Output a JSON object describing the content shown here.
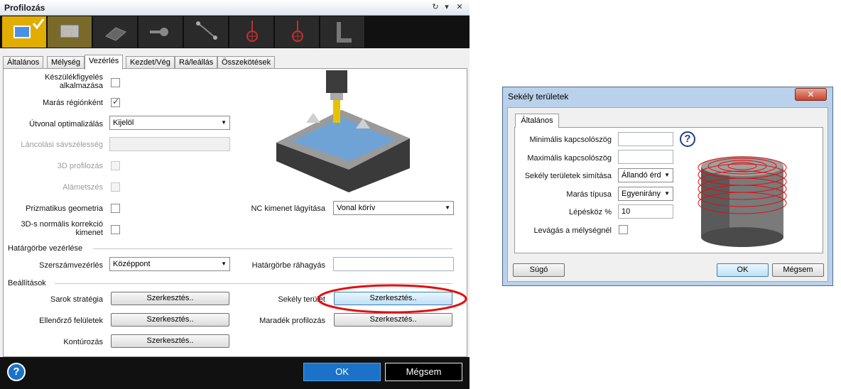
{
  "main": {
    "title": "Profilozás",
    "title_controls": [
      "↻",
      "▾",
      "✕"
    ],
    "tabs": [
      "Általános",
      "Mélység",
      "Vezérlés",
      "Kezdet/Vég",
      "Rá/leállás",
      "Összekötések"
    ],
    "active_tab": "Vezérlés",
    "fields": {
      "device_monitor_label": "Készülékfigyelés alkalmazása",
      "region_milling_label": "Marás régiónként",
      "path_opt_label": "Útvonal optimalizálás",
      "path_opt_value": "Kijelöl",
      "chain_bandwidth_label": "Láncolási sávszélesség",
      "profiling_3d_label": "3D profilozás",
      "undercut_label": "Alámetszés",
      "prismatic_label": "Prizmatikus geometria",
      "normal_correction_label": "3D-s normális korrekció kimenet",
      "nc_smoothing_label": "NC kimenet lágyítása",
      "nc_smoothing_value": "Vonal körív"
    },
    "boundary": {
      "section_title": "Határgörbe vezérlése",
      "tool_control_label": "Szerszámvezérlés",
      "tool_control_value": "Középpont",
      "overlap_label": "Határgörbe ráhagyás"
    },
    "settings": {
      "section_title": "Beállítások",
      "corner_label": "Sarok stratégia",
      "shallow_label": "Sekély terület",
      "check_surfaces_label": "Ellenőrző felületek",
      "residual_label": "Maradék profilozás",
      "contouring_label": "Kontúrozás",
      "edit_label": "Szerkesztés.."
    },
    "footer": {
      "help": "?",
      "ok": "OK",
      "cancel": "Mégsem"
    }
  },
  "dialog": {
    "title": "Sekély területek",
    "tab": "Általános",
    "min_gap_label": "Minimális kapcsolószög",
    "max_gap_label": "Maximális kapcsolószög",
    "smoothing_label": "Sekély területek simítása",
    "smoothing_value": "Állandó érd",
    "milling_type_label": "Marás típusa",
    "milling_type_value": "Egyenirány",
    "step_label": "Lépésköz %",
    "step_value": "10",
    "cut_at_depth_label": "Levágás a mélységnél",
    "help_icon": "?",
    "help_button": "Súgó",
    "ok": "OK",
    "cancel": "Mégsem",
    "close": "✕"
  },
  "colors": {
    "accent_yellow": "#e1ad00",
    "primary_blue": "#1a73c8",
    "highlight_red": "#e01010"
  }
}
